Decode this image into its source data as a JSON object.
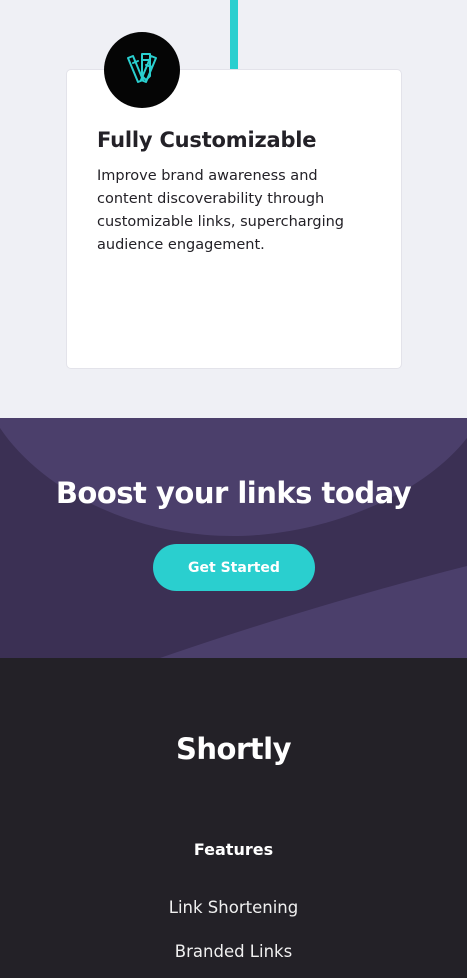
{
  "feature_card": {
    "icon": "fully-customizable-icon",
    "title": "Fully Customizable",
    "description": "Improve brand awareness and content discoverability through customizable links, supercharging audience engagement."
  },
  "boost": {
    "title": "Boost your links today",
    "cta_label": "Get Started"
  },
  "footer": {
    "logo": "Shortly",
    "features_heading": "Features",
    "links": [
      "Link Shortening",
      "Branded Links"
    ]
  },
  "colors": {
    "accent": "#2acfcf",
    "dark_violet": "#3b3054",
    "very_dark": "#232127",
    "light_bg": "#eff0f5"
  }
}
